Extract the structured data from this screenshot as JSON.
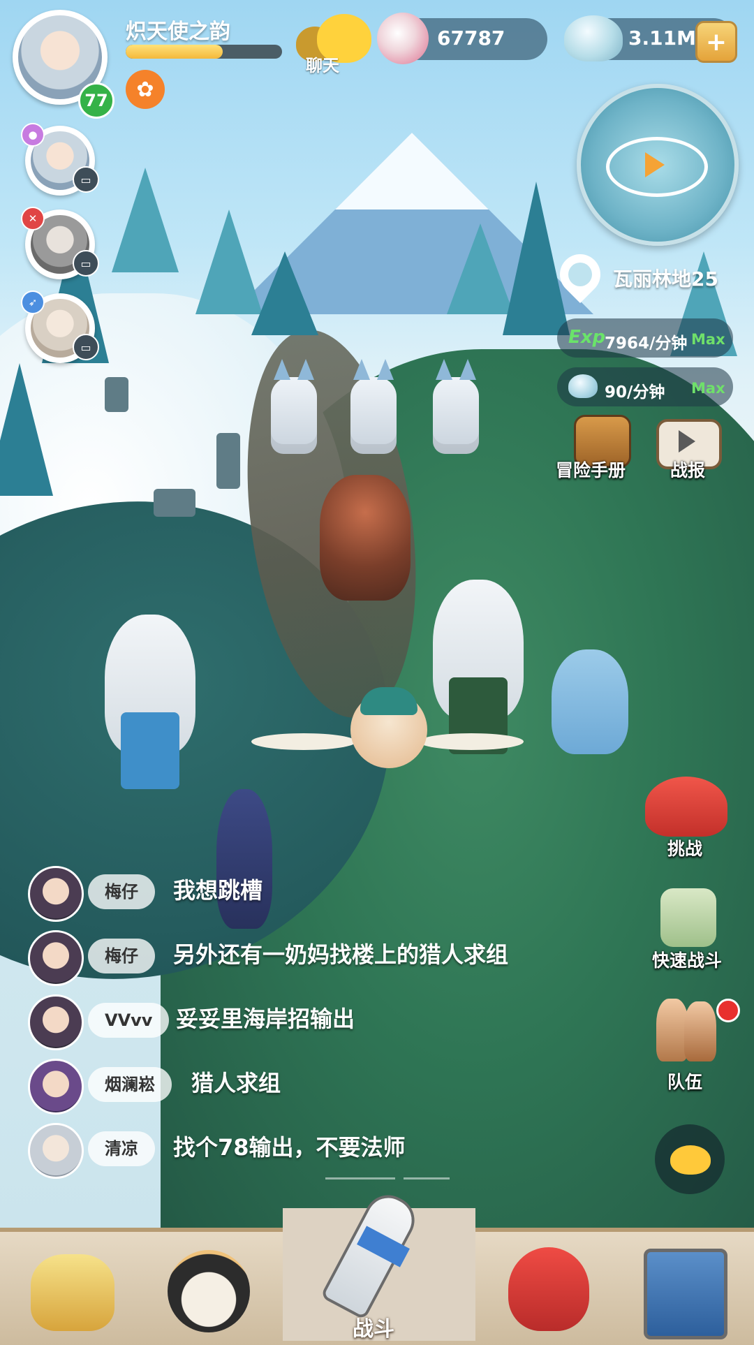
{
  "player": {
    "name": "炽天使之韵",
    "level": "77",
    "xp_fraction": 0.62
  },
  "chat_toggle": {
    "label": "聊天",
    "icon": "chat-bubbles-icon"
  },
  "currency": {
    "pearls": {
      "value": "67787",
      "icon": "pearl-shell-icon"
    },
    "shells": {
      "value": "3.11M",
      "icon": "shell-icon"
    },
    "add_icon": "plus-icon"
  },
  "location": {
    "name": "瓦丽林地25"
  },
  "rates": {
    "exp_tag": "Exp",
    "exp_rate": "7964/分钟",
    "exp_max": "Max",
    "shell_rate": "90/分钟",
    "shell_max": "Max"
  },
  "actions": {
    "handbook": "冒险手册",
    "battle_report": "战报",
    "challenge": "挑战",
    "quick_battle": "快速战斗",
    "team": "队伍"
  },
  "chat": [
    {
      "name": "梅仔",
      "message": "我想跳槽"
    },
    {
      "name": "梅仔",
      "message": "另外还有一奶妈找楼上的猎人求组"
    },
    {
      "name": "VVvv",
      "message": "妥妥里海岸招输出"
    },
    {
      "name": "烟澜崧",
      "message": "猎人求组"
    },
    {
      "name": "清凉",
      "message": "找个78输出，不要法师"
    }
  ],
  "bottom_nav": {
    "active_label": "战斗"
  },
  "colors": {
    "accent_gold": "#f4b83a",
    "level_green": "#35b248",
    "max_green": "#6fe06a",
    "alert_red": "#e8302e"
  }
}
